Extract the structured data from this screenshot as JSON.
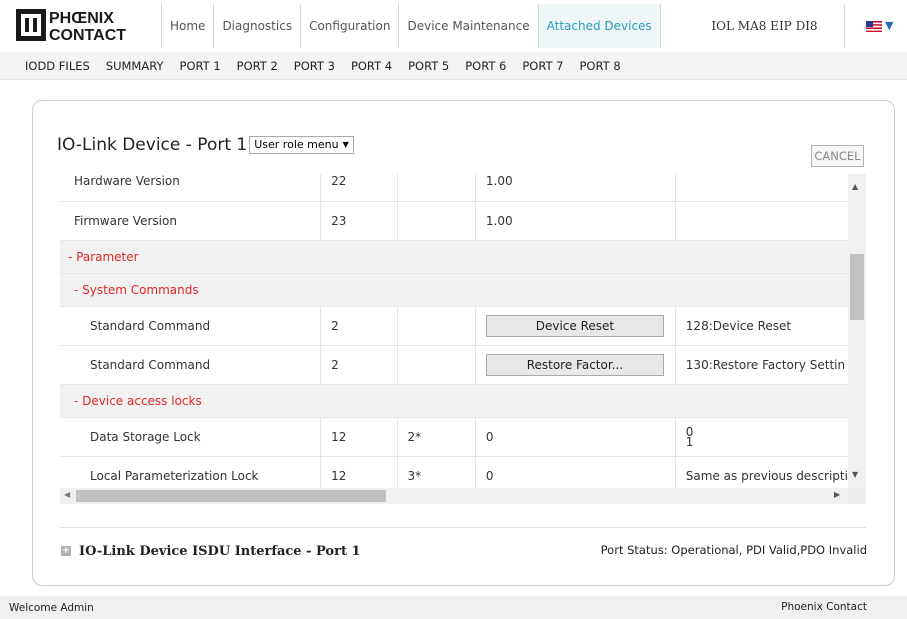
{
  "brand": {
    "logo_text": "PHOENIX CONTACT",
    "logo_color": "#1a1a1a"
  },
  "nav": {
    "items": [
      {
        "label": "Home"
      },
      {
        "label": "Diagnostics"
      },
      {
        "label": "Configuration"
      },
      {
        "label": "Device Maintenance"
      },
      {
        "label": "Attached Devices"
      }
    ],
    "active_index": 4,
    "active_color": "#2a9cb6",
    "device_name": "IOL MA8 EIP DI8",
    "language_icon": "us-flag-icon"
  },
  "subnav": {
    "items": [
      {
        "label": "IODD FILES"
      },
      {
        "label": "SUMMARY"
      },
      {
        "label": "PORT 1"
      },
      {
        "label": "PORT 2"
      },
      {
        "label": "PORT 3"
      },
      {
        "label": "PORT 4"
      },
      {
        "label": "PORT 5"
      },
      {
        "label": "PORT 6"
      },
      {
        "label": "PORT 7"
      },
      {
        "label": "PORT 8"
      }
    ]
  },
  "panel": {
    "title": "IO-Link Device - Port 1",
    "role_select_value": "User role menu",
    "cancel_label": "CANCEL"
  },
  "table": {
    "group_color": "#e02828",
    "rows": {
      "hardware": {
        "name": "Hardware Version",
        "index": "22",
        "subindex": "",
        "value": "1.00",
        "desc": ""
      },
      "firmware": {
        "name": "Firmware Version",
        "index": "23",
        "subindex": "",
        "value": "1.00",
        "desc": ""
      },
      "parameter_group": "- Parameter",
      "system_commands_group": "- System Commands",
      "std_cmd_1": {
        "name": "Standard Command",
        "index": "2",
        "subindex": "",
        "button": "Device Reset",
        "desc": "128:Device Reset"
      },
      "std_cmd_2": {
        "name": "Standard Command",
        "index": "2",
        "subindex": "",
        "button": "Restore Factor...",
        "desc": "130:Restore Factory Settin"
      },
      "access_locks_group": "- Device access locks",
      "data_storage_lock": {
        "name": "Data Storage Lock",
        "index": "12",
        "subindex": "2*",
        "value": "0",
        "desc_line1": "0",
        "desc_line2": "1"
      },
      "local_param_lock": {
        "name": "Local Parameterization Lock",
        "index": "12",
        "subindex": "3*",
        "value": "0",
        "desc": "Same as previous descripti"
      }
    }
  },
  "isdu": {
    "title": "IO-Link Device ISDU Interface - Port 1",
    "port_status": "Port Status: Operational, PDI Valid,PDO Invalid"
  },
  "footer": {
    "welcome": "Welcome Admin",
    "brand": "Phoenix Contact"
  }
}
